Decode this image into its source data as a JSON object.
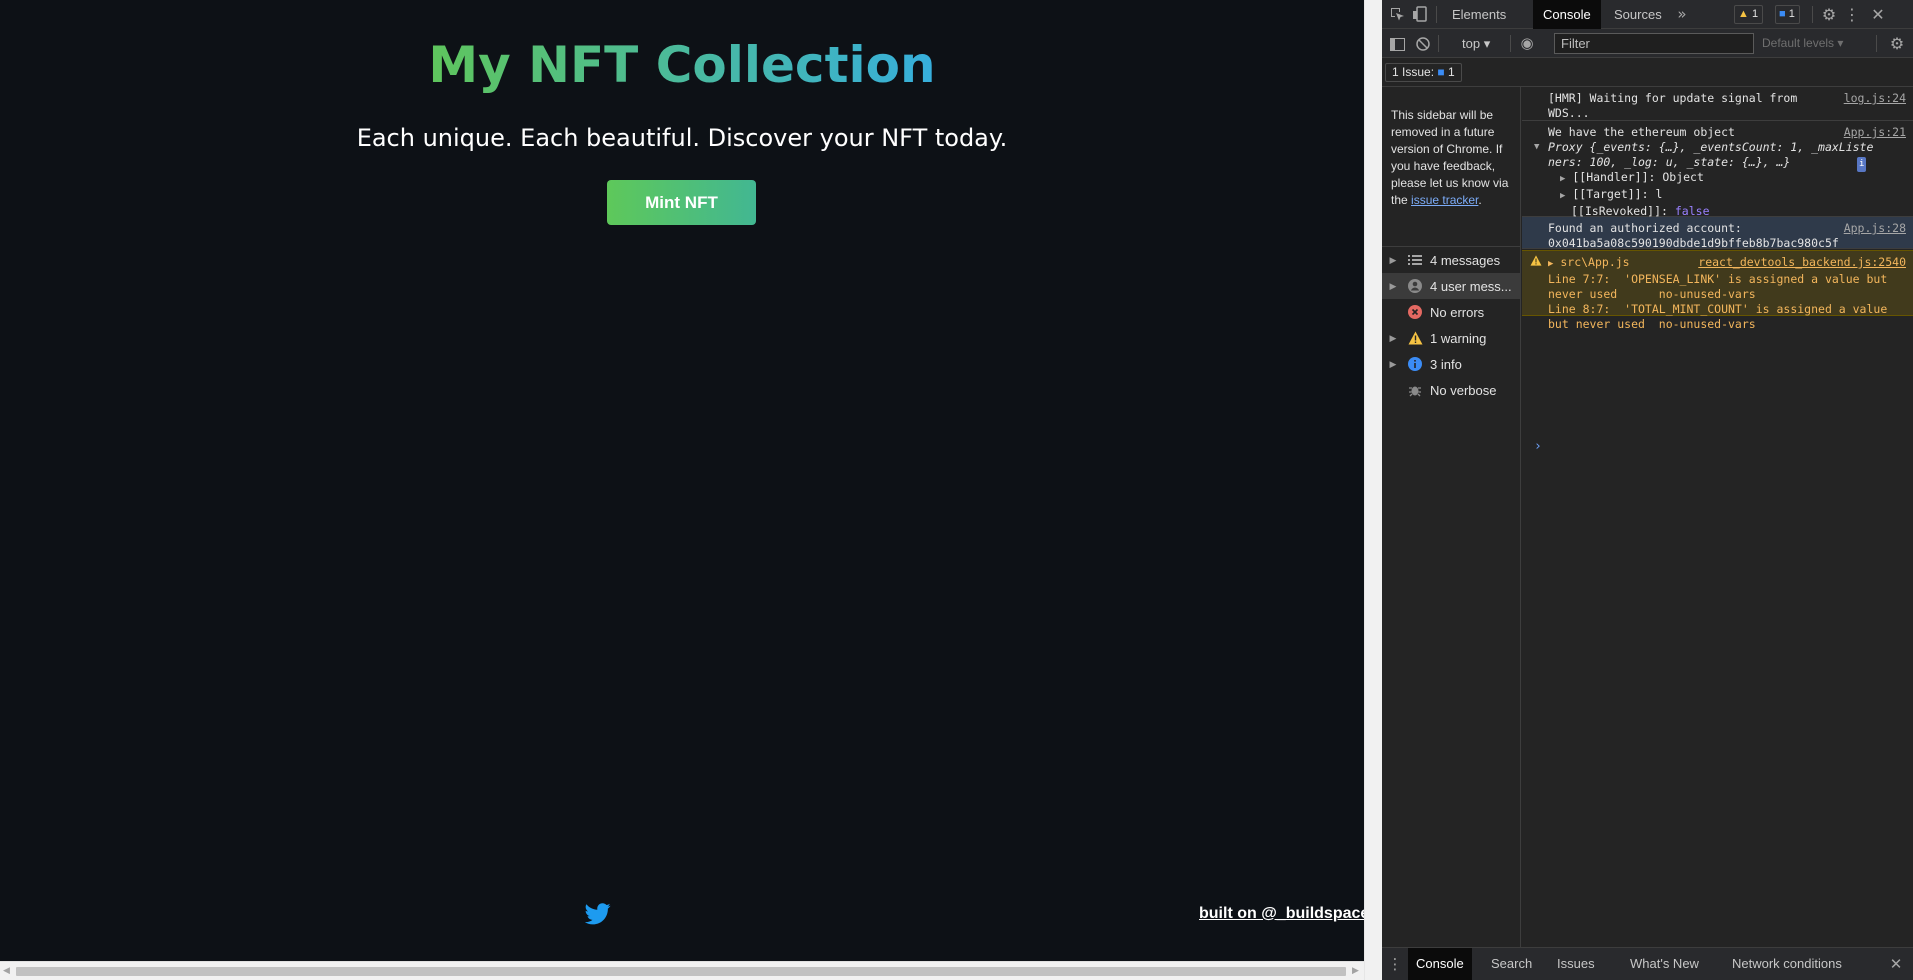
{
  "app": {
    "title": "My NFT Collection",
    "subtitle": "Each unique. Each beautiful. Discover your NFT today.",
    "mint_button": "Mint NFT",
    "footer_icon": "twitter-icon",
    "footer_link": "built on @_buildspace",
    "colors": {
      "background": "#0d1116",
      "gradient_start": "#60c657",
      "gradient_end": "#35aee2"
    }
  },
  "devtools": {
    "tabs": [
      "Elements",
      "Console",
      "Sources"
    ],
    "active_tab": "Console",
    "warning_badge": "1",
    "message_badge": "1",
    "context": "top",
    "filter_placeholder": "Filter",
    "levels": "Default levels",
    "issues_button": "1 Issue:",
    "issues_count": "1",
    "sidebar_notice": {
      "text": "This sidebar will be removed in a future version of Chrome. If you have feedback, please let us know via the",
      "link": "issue tracker",
      "end": "."
    },
    "sidebar_items": [
      {
        "label": "4 messages",
        "icon": "list-icon"
      },
      {
        "label": "4 user mess...",
        "icon": "user-icon"
      },
      {
        "label": "No errors",
        "icon": "error-icon"
      },
      {
        "label": "1 warning",
        "icon": "warning-icon"
      },
      {
        "label": "3 info",
        "icon": "info-icon"
      },
      {
        "label": "No verbose",
        "icon": "bug-icon"
      }
    ],
    "messages": {
      "hmr": {
        "text": "[HMR] Waiting for update signal from WDS...",
        "source": "log.js:24"
      },
      "eth": {
        "text": "We have the ethereum object",
        "source": "App.js:21"
      },
      "proxy_line1": "Proxy {_events: {…}, _eventsCount: 1, _maxListeners: 100, _log: u, _state: {…}, …}",
      "handler": "[[Handler]]: Object",
      "target": "[[Target]]: l",
      "revoked_key": "[[IsRevoked]]:",
      "revoked_val": "false",
      "account": {
        "text": "Found an authorized account:",
        "value": "0x041ba5a08c590190dbde1d9bffeb8b7bac980c5f",
        "source": "App.js:28"
      },
      "warning": {
        "file": "src\\App.js",
        "source": "react_devtools_backend.js:2540",
        "line1": "Line 7:7:  'OPENSEA_LINK' is assigned a value but never used      no-unused-vars",
        "line2": "Line 8:7:  'TOTAL_MINT_COUNT' is assigned a value but never used  no-unused-vars"
      }
    },
    "drawer_tabs": [
      "Console",
      "Search",
      "Issues",
      "What's New",
      "Network conditions"
    ]
  }
}
